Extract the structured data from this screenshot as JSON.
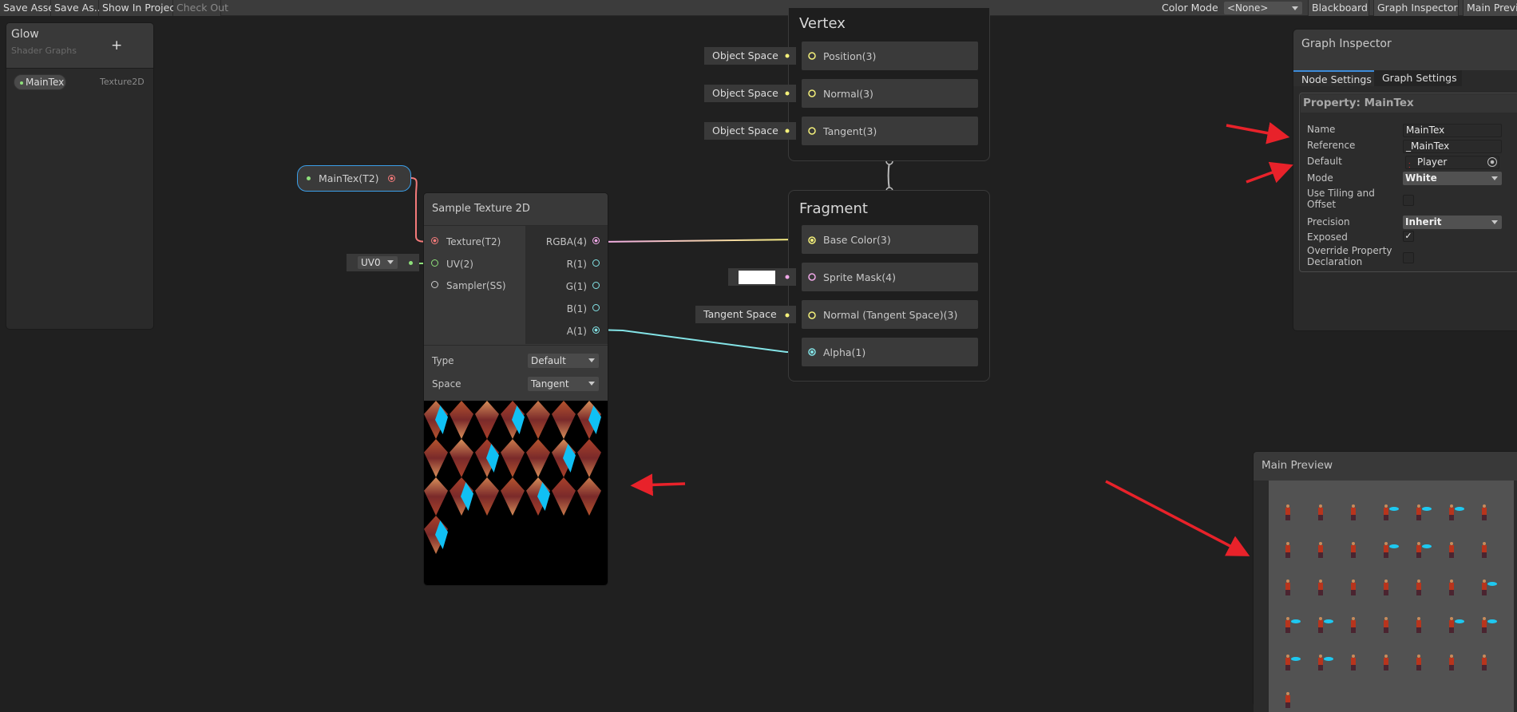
{
  "toolbar": {
    "save_asset": "Save Asset",
    "save_as": "Save As...",
    "show_in_project": "Show In Project",
    "check_out": "Check Out",
    "color_mode_label": "Color Mode",
    "color_mode_value": "<None>",
    "blackboard": "Blackboard",
    "graph_inspector": "Graph Inspector",
    "main_preview": "Main Preview"
  },
  "blackboard": {
    "title": "Glow",
    "subtitle": "Shader Graphs",
    "add_icon": "plus-icon",
    "properties": [
      {
        "name": "MainTex",
        "type": "Texture2D"
      }
    ]
  },
  "nodes": {
    "property_node": {
      "label": "MainTex(T2)"
    },
    "uv_node": {
      "value": "UV0"
    },
    "sample_texture": {
      "title": "Sample Texture 2D",
      "inputs": [
        "Texture(T2)",
        "UV(2)",
        "Sampler(SS)"
      ],
      "outputs": [
        "RGBA(4)",
        "R(1)",
        "G(1)",
        "B(1)",
        "A(1)"
      ],
      "type_label": "Type",
      "type_value": "Default",
      "space_label": "Space",
      "space_value": "Tangent"
    },
    "vertex": {
      "title": "Vertex",
      "ports": [
        "Position(3)",
        "Normal(3)",
        "Tangent(3)"
      ],
      "inputs": [
        "Object Space",
        "Object Space",
        "Object Space"
      ]
    },
    "fragment": {
      "title": "Fragment",
      "ports": [
        "Base Color(3)",
        "Sprite Mask(4)",
        "Normal (Tangent Space)(3)",
        "Alpha(1)"
      ],
      "normal_input": "Tangent Space",
      "sprite_mask_color": "#ffffff"
    }
  },
  "inspector": {
    "title": "Graph Inspector",
    "tabs": [
      "Node Settings",
      "Graph Settings"
    ],
    "active_tab": "Node Settings",
    "section_title": "Property: MainTex",
    "fields": {
      "name_label": "Name",
      "name_value": "MainTex",
      "reference_label": "Reference",
      "reference_value": "_MainTex",
      "default_label": "Default",
      "default_value": "Player",
      "mode_label": "Mode",
      "mode_value": "White",
      "tiling_label": "Use Tiling and Offset",
      "tiling_checked": false,
      "precision_label": "Precision",
      "precision_value": "Inherit",
      "exposed_label": "Exposed",
      "exposed_checked": true,
      "exposed_mark": "✓",
      "override_label": "Override Property Declaration",
      "override_checked": false
    }
  },
  "main_preview": {
    "title": "Main Preview"
  },
  "colors": {
    "texture_port": "#f47a7a",
    "uv_port": "#8ee07a",
    "vector4": "#f0a8e8",
    "vector3": "#f4f07a",
    "float": "#84e4e7",
    "annotation_arrow": "#e8222a",
    "accent": "#3d8bd9"
  }
}
